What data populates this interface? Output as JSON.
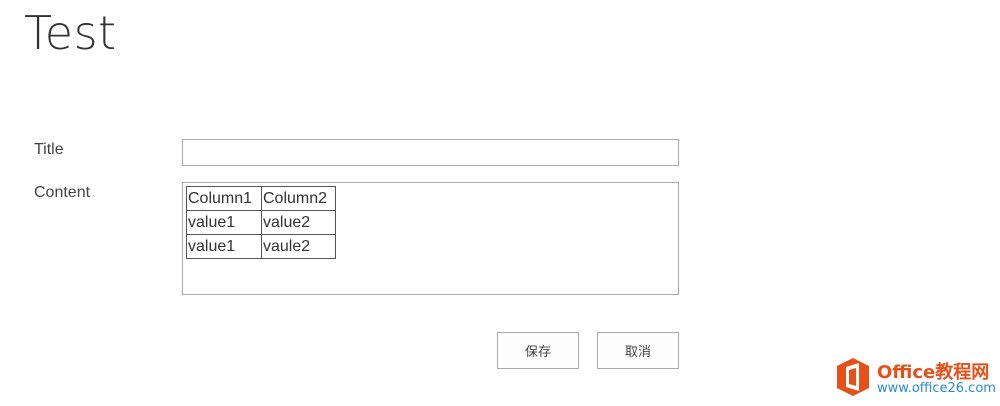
{
  "page": {
    "title": "Test"
  },
  "form": {
    "title_label": "Title",
    "title_value": "",
    "content_label": "Content",
    "content_table": {
      "rows": [
        [
          "Column1",
          "Column2"
        ],
        [
          "value1",
          "value2"
        ],
        [
          "value1",
          "vaule2"
        ]
      ]
    }
  },
  "buttons": {
    "save_label": "保存",
    "cancel_label": "取消"
  },
  "watermark": {
    "brand": "Office教程网",
    "url": "www.office26.com",
    "logo_icon": "office-logo-icon",
    "brand_color": "#e8501a",
    "url_color": "#2a8bd6"
  }
}
